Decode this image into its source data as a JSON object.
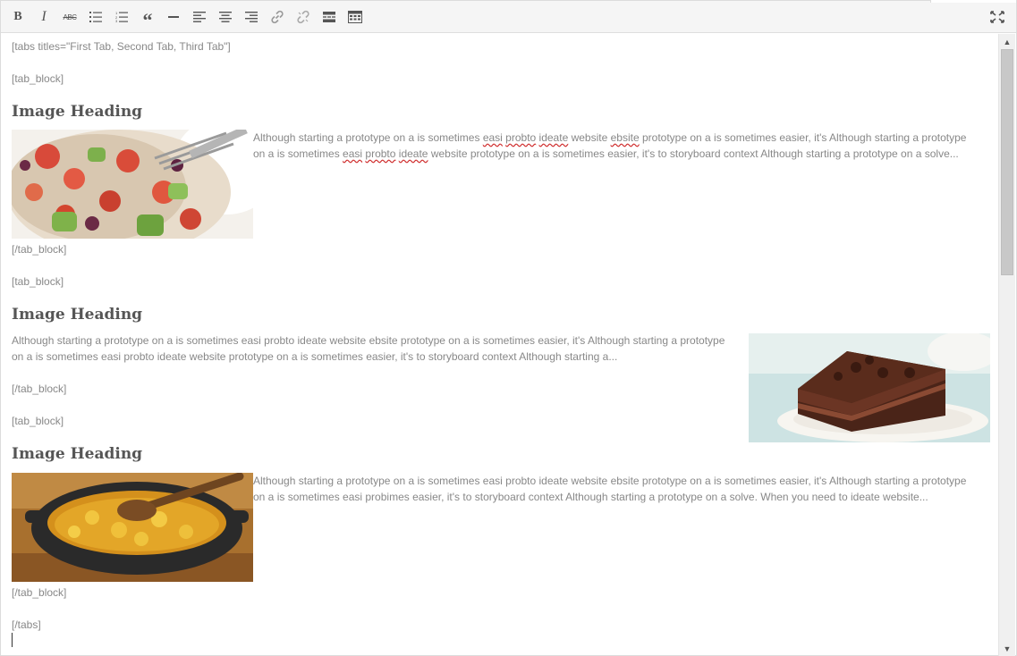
{
  "toolbar": {
    "bold": "B",
    "italic": "I",
    "strike": "ABC",
    "quote": "“"
  },
  "content": {
    "line1": "[tabs titles=\"First Tab, Second Tab, Third Tab\"]",
    "block_open": "[tab_block]",
    "block_close": "[/tab_block]",
    "tabs_close": "[/tabs]",
    "heading": "Image Heading",
    "para1_l1_pre": "Although starting a prototype on a is sometimes ",
    "para1_l1_s1": "easi",
    "para1_l1_s2": "probto",
    "para1_l1_s3": "ideate",
    "para1_l1_post": " website ",
    "para1_l1_s4": "ebsite",
    "para1_l1_end": " prototype on a is sometimes easier, it's Although starting a prototype",
    "para1_l2_pre": "on a is sometimes ",
    "para1_l2_s1": "easi",
    "para1_l2_s2": "probto",
    "para1_l2_s3": "ideate",
    "para1_l2_end": " website prototype on a is sometimes easier, it's to storyboard context Although starting a prototype on a solve...",
    "para2_l1": "Although starting a prototype on a is sometimes easi probto ideate website ebsite prototype on a is sometimes easier, it's Although starting a prototype",
    "para2_l2": "on a is sometimes easi probto ideate website prototype on a is sometimes easier, it's to storyboard context Although starting a...",
    "para3_l1": "Although starting a prototype on a is sometimes easi probto ideate website ebsite prototype on a is sometimes easier, it's Although starting a prototype",
    "para3_l2": "on a is sometimes easi probimes easier, it's to storyboard context Although starting a prototype on a solve. When you need to ideate website..."
  },
  "colors": {
    "toolbar_bg": "#f5f5f5",
    "text": "#888888",
    "heading": "#555555",
    "spell_underline": "#d03030"
  }
}
